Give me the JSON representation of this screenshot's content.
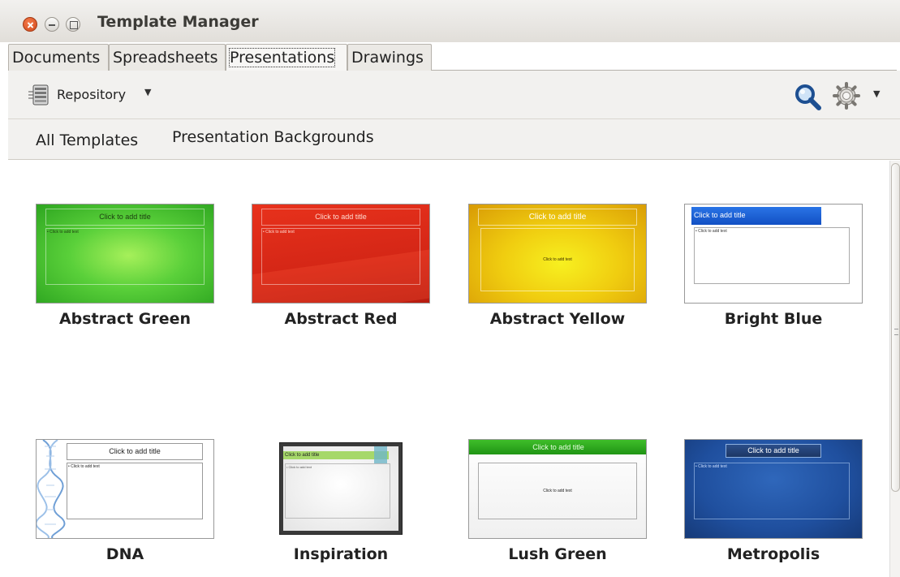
{
  "window": {
    "title": "Template Manager"
  },
  "tabs": [
    "Documents",
    "Spreadsheets",
    "Presentations",
    "Drawings"
  ],
  "active_tab": "Presentations",
  "toolbar": {
    "repository_label": "Repository"
  },
  "filters": {
    "all": "All Templates",
    "backgrounds": "Presentation Backgrounds"
  },
  "templates": [
    {
      "name": "Abstract Green",
      "title_placeholder": "Click to add title",
      "text_placeholder": "Click to add text"
    },
    {
      "name": "Abstract Red",
      "title_placeholder": "Click to add title",
      "text_placeholder": "Click to add text"
    },
    {
      "name": "Abstract Yellow",
      "title_placeholder": "Click to add title",
      "text_placeholder": "Click to add text"
    },
    {
      "name": "Bright Blue",
      "title_placeholder": "Click to add title",
      "text_placeholder": "Click to add text"
    },
    {
      "name": "DNA",
      "title_placeholder": "Click to add title",
      "text_placeholder": "Click to add text"
    },
    {
      "name": "Inspiration",
      "title_placeholder": "Click to add title",
      "text_placeholder": "Click to add text"
    },
    {
      "name": "Lush Green",
      "title_placeholder": "Click to add title",
      "text_placeholder": "Click to add text"
    },
    {
      "name": "Metropolis",
      "title_placeholder": "Click to add title",
      "text_placeholder": "Click to add text"
    }
  ],
  "colors": {
    "abstract_green": "#3cc428",
    "abstract_red": "#e02818",
    "abstract_yellow": "#ecc20a",
    "bright_blue": "#1a5fd0",
    "lush_green": "#26a21a",
    "metropolis": "#1f4f9e",
    "window_close": "#e2562a"
  },
  "icons": {
    "window_close": "close-icon",
    "window_minimize": "minimize-icon",
    "window_maximize": "maximize-icon",
    "repository": "server-icon",
    "search": "search-icon",
    "settings": "gear-icon"
  }
}
